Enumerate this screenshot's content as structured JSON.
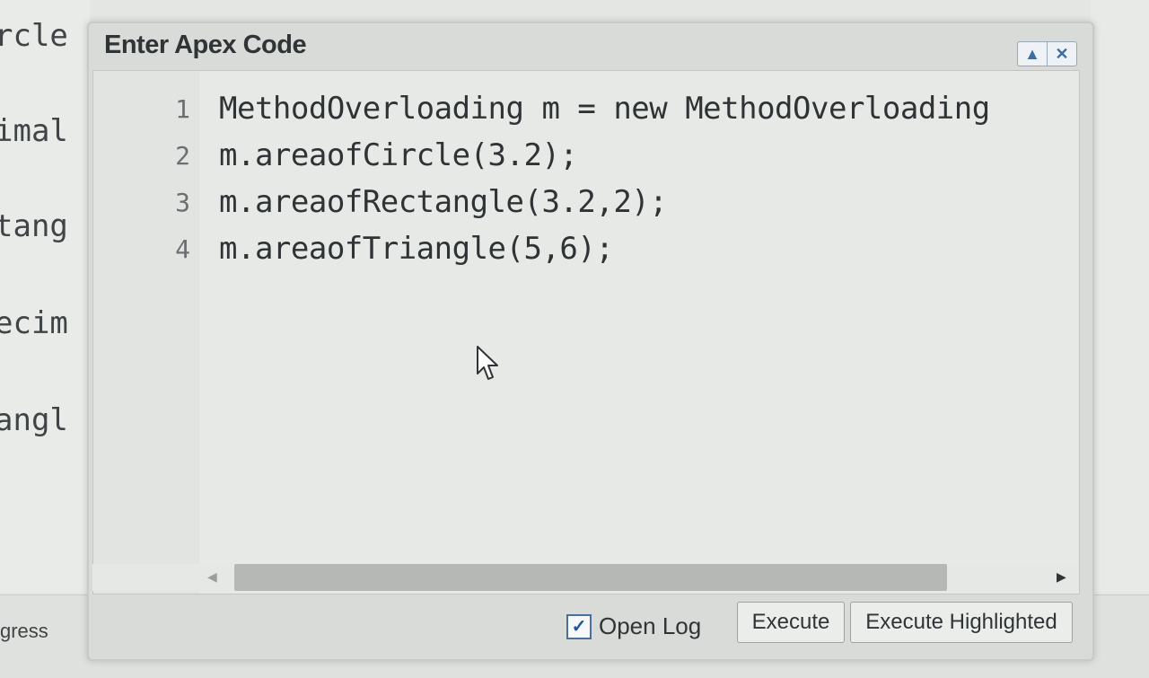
{
  "background": {
    "code_fragments": [
      "rcle",
      "imal",
      "tang",
      "ecim",
      "angl"
    ],
    "progress_label": "gress"
  },
  "dialog": {
    "title": "Enter Apex Code",
    "title_buttons": [
      "▲",
      "✕"
    ],
    "editor": {
      "lines": [
        {
          "number": "1",
          "text": "MethodOverloading m = new MethodOverloading"
        },
        {
          "number": "2",
          "text": "m.areaofCircle(3.2);"
        },
        {
          "number": "3",
          "text": "m.areaofRectangle(3.2,2);"
        },
        {
          "number": "4",
          "text": "m.areaofTriangle(5,6);"
        }
      ]
    },
    "footer": {
      "open_log_label": "Open Log",
      "open_log_checked": true,
      "execute_label": "Execute",
      "execute_highlighted_label": "Execute Highlighted"
    }
  },
  "colors": {
    "accent": "#3a6ea5",
    "text": "#2f3437"
  }
}
